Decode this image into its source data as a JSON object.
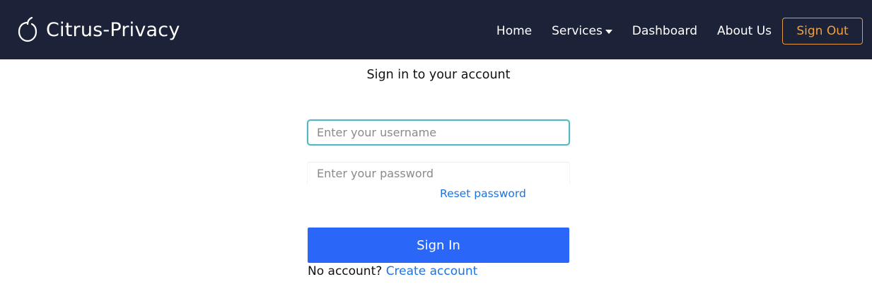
{
  "navbar": {
    "brand_name": "Citrus-Privacy",
    "brand_icon": "citrus-icon",
    "links": {
      "home": "Home",
      "services": "Services",
      "dashboard": "Dashboard",
      "about": "About Us"
    },
    "signout_label": "Sign Out"
  },
  "form": {
    "heading": "Sign in to your account",
    "username_placeholder": "Enter your username",
    "password_placeholder": "Enter your password",
    "reset_label": "Reset password",
    "signin_label": "Sign In",
    "no_account_text": "No account?",
    "create_account_label": "Create account"
  },
  "colors": {
    "navbar_bg": "#1c2238",
    "signout_accent": "#f0a040",
    "primary_button": "#2a66f7",
    "link": "#1a73e8",
    "focus_border": "#55b8c0"
  }
}
